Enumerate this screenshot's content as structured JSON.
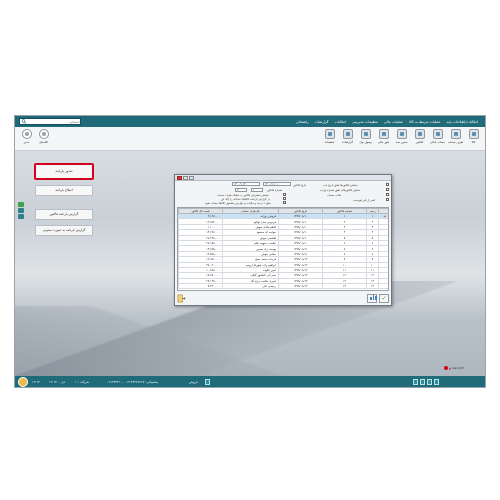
{
  "menubar": {
    "items": [
      "امکانات/اطلاعات پایه",
      "عملیات مرتبط به کالا",
      "عملیات مالی",
      "تنظیمات مدیریتی",
      "امکانات",
      "گزارشات",
      "راهنمائی"
    ],
    "search_placeholder": "جستجو ..."
  },
  "toolbar": {
    "right_buttons": [
      "کالا",
      "طرف حساب",
      "حساب بانکی",
      "فاکتور",
      "صدور سند",
      "امور مالی",
      "وصول چک",
      "گزارشات",
      "تنظیمات"
    ],
    "left_buttons": [
      "کلاسیک",
      "مدیر"
    ]
  },
  "sidebar_buttons": [
    "صدور بارنامه",
    "اصلاح بارنامه",
    "گزارش بارنامه فاکتور",
    "گزارش بارنامه به صورت ستونی"
  ],
  "dialog": {
    "filters": {
      "date_label": "تاریخ فاکتور",
      "date_from": "۱۴۰۰/۱۰/۰۱",
      "date_to": "۱۴۰۰/۱۰/۳۰",
      "invoice_no_label": "شماره فاکتور",
      "invoice_from": "۱",
      "invoice_to": "۲۰",
      "opt1": "نمایش فاکتورها طبق تاریخ ثبت",
      "opt2": "نمایش فاکتورهای طبق شماره وارده",
      "opt3": "نمایش مشتریان فاکتور به تفکیک طرف حساب",
      "opt4": "در گزارش بارنامه کالاهای تعدادی را چک کن",
      "opt5": "مبلغ ۱ درصد و مالیات و عوارض مشمول کالاها حساب شود",
      "opt6": "کسر از فی فهرست",
      "opt7": "شماره فاکتور",
      "opt8": "حالت حساب"
    },
    "columns": [
      "ردیف",
      "شماره فاکتور",
      "تاریخ فاکتور",
      "نام طرف حساب",
      "قیمت کل فاکتور"
    ],
    "rows": [
      [
        "۱",
        "۱",
        "۱۳۹۹/۰۸/۱۰",
        "فروش روزانه",
        "۴,۶۶۷,۰۰۰"
      ],
      [
        "۲",
        "۲",
        "۱۳۹۹/۰۸/۱۰",
        "فردوس سارا توکلو",
        "۱۲,۸۷۲,۰۰۰"
      ],
      [
        "۳",
        "۳",
        "۱۳۹۹/۰۸/۱۰",
        "کاظم هادی خوش",
        "۱,۱۰۰,۰۰۰"
      ],
      [
        "۴",
        "۴",
        "۱۳۹۹/۰۸/۱۰",
        "خواجه ای محمود",
        "۱۴,۶۲۷,۰۰۰"
      ],
      [
        "۵",
        "۵",
        "۱۳۹۹/۰۸/۱۰",
        "هاشمی خوش",
        "۲۸,۶۳۸,۰۰۰"
      ],
      [
        "۶",
        "۶",
        "۱۳۹۹/۰۸/۱۰",
        "نیکبخت صهیب قلم",
        "۲۷,۱۵۷,۰۰۰"
      ],
      [
        "۷",
        "۷",
        "۱۳۹۹/۰۸/۱۱",
        "یوسف زاد حسین",
        "۱۴,۶۹۵,۰۰۰"
      ],
      [
        "۸",
        "۸",
        "۱۳۹۹/۰۸/۱۱",
        "حقانی خوش",
        "۱۳,۵۸۸,۰۰۰"
      ],
      [
        "۹",
        "۹",
        "۱۳۹۹/۰۸/۱۲",
        "فریدی محمد حنیج",
        "۱۲,۸۸۱,۰۰۰"
      ],
      [
        "۱۰",
        "۱۰",
        "۱۳۹۹/۰۸/۱۲",
        "ابراهیم زاده شهرام ارومیه",
        "۳۷,۰۳۰,۰۰۰"
      ],
      [
        "۱۱",
        "۱۱",
        "۱۳۹۹/۰۸/۱۲",
        "امین یاقوت",
        "۱۰,۸۸۸,۰۰۰"
      ],
      [
        "۱۲",
        "۱۲",
        "۱۳۹۹/۰۸/۱۳",
        "صبر آتی کیاشهر گیلان",
        "۱۷,۶۵۰,۰۰۰"
      ],
      [
        "۱۳",
        "۱۳",
        "۱۳۹۹/۰۸/۱۳",
        "امیری خالصه خرم آباد",
        "۲۴,۱۳۹,۰۰۰"
      ],
      [
        "۱۴",
        "۱۴",
        "۱۳۹۹/۰۸/۱۳",
        "رحیمی علی",
        "۹,۴۲۰,۰۰۰"
      ]
    ]
  },
  "statusbar": {
    "user": "فروش",
    "phone": "پشتیبانی: ۰۲۱۴۴۲۷۱۲۶۷ - ۰۲۱۴۴۴۲۱۰",
    "branch": "شرکت : ۱",
    "date": "۱۳ دی ۱۴۰۰",
    "time": "۱۲:۱۴",
    "brand": "Yaali Soft"
  }
}
